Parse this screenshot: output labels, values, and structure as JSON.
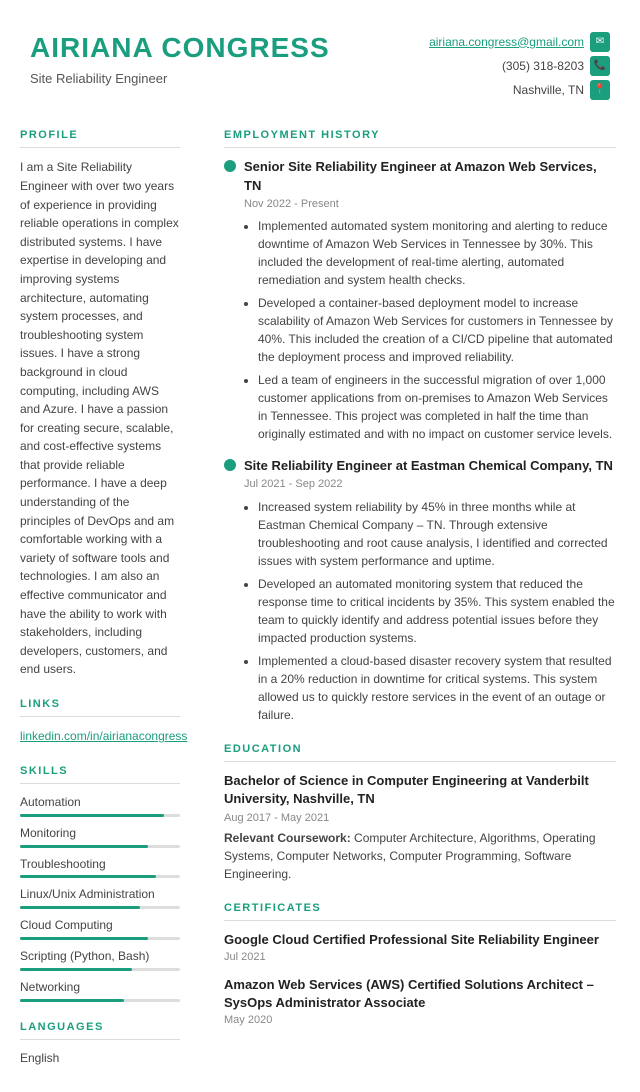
{
  "header": {
    "name": "AIRIANA CONGRESS",
    "title": "Site Reliability Engineer",
    "email": "airiana.congress@gmail.com",
    "phone": "(305) 318-8203",
    "location": "Nashville, TN"
  },
  "profile": {
    "section_label": "PROFILE",
    "text": "I am a Site Reliability Engineer with over two years of experience in providing reliable operations in complex distributed systems. I have expertise in developing and improving systems architecture, automating system processes, and troubleshooting system issues. I have a strong background in cloud computing, including AWS and Azure. I have a passion for creating secure, scalable, and cost-effective systems that provide reliable performance. I have a deep understanding of the principles of DevOps and am comfortable working with a variety of software tools and technologies. I am also an effective communicator and have the ability to work with stakeholders, including developers, customers, and end users."
  },
  "links": {
    "section_label": "LINKS",
    "items": [
      {
        "text": "linkedin.com/in/airianacongress",
        "url": "#"
      }
    ]
  },
  "skills": {
    "section_label": "SKILLS",
    "items": [
      {
        "name": "Automation",
        "level": 90
      },
      {
        "name": "Monitoring",
        "level": 80
      },
      {
        "name": "Troubleshooting",
        "level": 85
      },
      {
        "name": "Linux/Unix Administration",
        "level": 75
      },
      {
        "name": "Cloud Computing",
        "level": 80
      },
      {
        "name": "Scripting (Python, Bash)",
        "level": 70
      },
      {
        "name": "Networking",
        "level": 65
      }
    ]
  },
  "languages": {
    "section_label": "LANGUAGES",
    "items": [
      {
        "name": "English"
      }
    ]
  },
  "employment": {
    "section_label": "EMPLOYMENT HISTORY",
    "jobs": [
      {
        "title": "Senior Site Reliability Engineer at Amazon Web Services, TN",
        "dates": "Nov 2022 - Present",
        "bullets": [
          "Implemented automated system monitoring and alerting to reduce downtime of Amazon Web Services in Tennessee by 30%. This included the development of real-time alerting, automated remediation and system health checks.",
          "Developed a container-based deployment model to increase scalability of Amazon Web Services for customers in Tennessee by 40%. This included the creation of a CI/CD pipeline that automated the deployment process and improved reliability.",
          "Led a team of engineers in the successful migration of over 1,000 customer applications from on-premises to Amazon Web Services in Tennessee. This project was completed in half the time than originally estimated and with no impact on customer service levels."
        ]
      },
      {
        "title": "Site Reliability Engineer at Eastman Chemical Company, TN",
        "dates": "Jul 2021 - Sep 2022",
        "bullets": [
          "Increased system reliability by 45% in three months while at Eastman Chemical Company – TN.  Through extensive troubleshooting and root cause analysis, I identified and corrected issues with system performance and uptime.",
          "Developed an automated monitoring system that reduced the response time to critical incidents by 35%. This system enabled the team to quickly identify and address potential issues before they impacted production systems.",
          "Implemented a cloud-based disaster recovery system that resulted in a 20% reduction in downtime for critical systems. This system allowed us to quickly restore services in the event of an outage or failure."
        ]
      }
    ]
  },
  "education": {
    "section_label": "EDUCATION",
    "degree": "Bachelor of Science in Computer Engineering at Vanderbilt University, Nashville, TN",
    "dates": "Aug 2017 - May 2021",
    "coursework_label": "Relevant Coursework:",
    "coursework": "Computer Architecture, Algorithms, Operating Systems, Computer Networks, Computer Programming, Software Engineering."
  },
  "certificates": {
    "section_label": "CERTIFICATES",
    "items": [
      {
        "title": "Google Cloud Certified Professional Site Reliability Engineer",
        "date": "Jul 2021"
      },
      {
        "title": "Amazon Web Services (AWS) Certified Solutions Architect – SysOps Administrator Associate",
        "date": "May 2020"
      }
    ]
  }
}
